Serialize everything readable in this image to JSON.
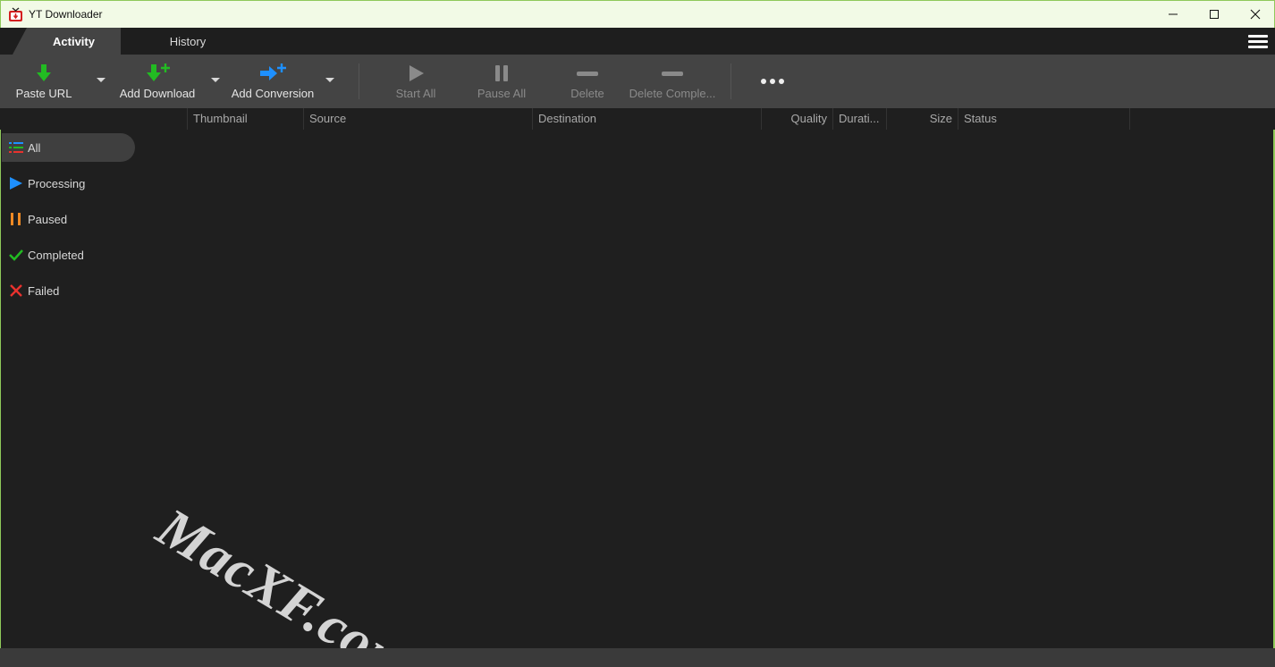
{
  "window": {
    "title": "YT Downloader",
    "icon": "yt-downloader-app-icon",
    "controls": [
      "minimize-icon",
      "maximize-icon",
      "close-icon"
    ]
  },
  "tabs": [
    {
      "label": "Activity",
      "active": true
    },
    {
      "label": "History",
      "active": false
    }
  ],
  "menu_icon": "hamburger-menu-icon",
  "toolbar": {
    "paste_url": "Paste URL",
    "add_download": "Add Download",
    "add_conversion": "Add Conversion",
    "start_all": "Start All",
    "pause_all": "Pause All",
    "delete": "Delete",
    "delete_completed": "Delete Comple...",
    "more_icon": "more-options-icon"
  },
  "columns": {
    "thumbnail": "Thumbnail",
    "source": "Source",
    "destination": "Destination",
    "quality": "Quality",
    "duration": "Durati...",
    "size": "Size",
    "status": "Status"
  },
  "sidebar": {
    "items": [
      {
        "label": "All",
        "icon": "list-icon",
        "active": true
      },
      {
        "label": "Processing",
        "icon": "play-icon",
        "active": false
      },
      {
        "label": "Paused",
        "icon": "pause-icon",
        "active": false
      },
      {
        "label": "Completed",
        "icon": "checkmark-icon",
        "active": false
      },
      {
        "label": "Failed",
        "icon": "x-icon",
        "active": false
      }
    ]
  },
  "watermark": "MacXF.com",
  "colors": {
    "green": "#22bb22",
    "blue": "#1e90ff",
    "orange": "#f08a24",
    "red": "#e8322e",
    "titlebar_bg": "#f2fae6"
  }
}
